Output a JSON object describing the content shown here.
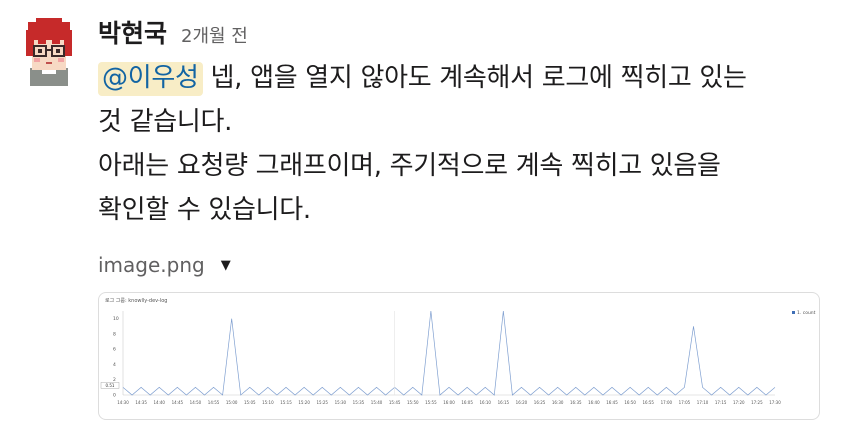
{
  "message": {
    "author": "박현국",
    "timestamp": "2개월 전",
    "mention": "@이우성",
    "line1_rest": " 넵, 앱을 열지 않아도 계속해서 로그에 찍히고 있는",
    "line2": "것 같습니다.",
    "line3": "아래는 요청량 그래프이며, 주기적으로 계속 찍히고 있음을",
    "line4": "확인할 수 있습니다."
  },
  "attachment": {
    "filename": "image.png",
    "toggle_icon": "caret-down-icon"
  },
  "chart_data": {
    "type": "line",
    "title": "로그 그룹: knowlly-dev-log",
    "legend": [
      "1. count"
    ],
    "ylim": [
      0,
      11
    ],
    "y_ticks": [
      "0",
      "2",
      "4",
      "6",
      "8",
      "10"
    ],
    "threshold_label": "0.51",
    "x_ticks": [
      "14:30",
      "14:35",
      "14:40",
      "14:45",
      "14:50",
      "14:55",
      "15:00",
      "15:05",
      "15:10",
      "15:15",
      "15:20",
      "15:25",
      "15:30",
      "15:35",
      "15:40",
      "15:45",
      "15:50",
      "15:55",
      "16:00",
      "16:05",
      "16:10",
      "16:15",
      "16:20",
      "16:25",
      "16:30",
      "16:35",
      "16:40",
      "16:45",
      "16:50",
      "16:55",
      "17:00",
      "17:05",
      "17:10",
      "17:15",
      "17:20",
      "17:25",
      "17:30"
    ],
    "spikes": [
      {
        "x": "15:00",
        "y": 10
      },
      {
        "x": "15:55",
        "y": 11
      },
      {
        "x": "16:15",
        "y": 11
      },
      {
        "x": "17:07",
        "y": 9
      }
    ],
    "baseline_range": [
      0,
      1
    ],
    "series_color": "#7f9fd0"
  },
  "colors": {
    "mention_bg": "#f8edc6",
    "mention_text": "#1264a3"
  }
}
